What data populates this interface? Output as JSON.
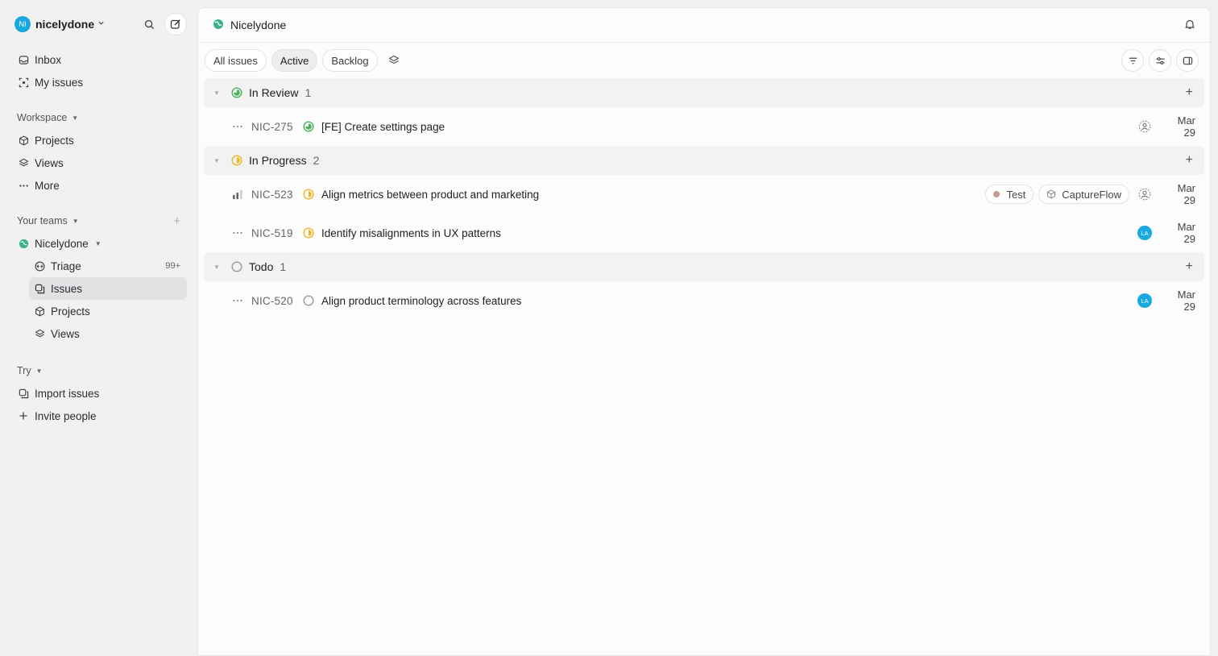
{
  "workspace": {
    "initials": "NI",
    "name": "nicelydone"
  },
  "nav": {
    "inbox": "Inbox",
    "my_issues": "My issues"
  },
  "workspace_section": {
    "label": "Workspace",
    "items": [
      {
        "label": "Projects"
      },
      {
        "label": "Views"
      },
      {
        "label": "More"
      }
    ]
  },
  "teams_section": {
    "label": "Your teams",
    "team": {
      "name": "Nicelydone"
    },
    "items": [
      {
        "label": "Triage",
        "badge": "99+"
      },
      {
        "label": "Issues"
      },
      {
        "label": "Projects"
      },
      {
        "label": "Views"
      }
    ]
  },
  "try_section": {
    "label": "Try",
    "items": [
      {
        "label": "Import issues"
      },
      {
        "label": "Invite people"
      }
    ]
  },
  "header": {
    "title": "Nicelydone"
  },
  "tabs": [
    {
      "label": "All issues"
    },
    {
      "label": "Active"
    },
    {
      "label": "Backlog"
    }
  ],
  "groups": [
    {
      "name": "In Review",
      "count": "1",
      "issues": [
        {
          "id": "NIC-275",
          "title": "[FE] Create settings page",
          "date": "Mar 29"
        }
      ]
    },
    {
      "name": "In Progress",
      "count": "2",
      "issues": [
        {
          "id": "NIC-523",
          "title": "Align metrics between product and marketing",
          "label": "Test",
          "project": "CaptureFlow",
          "date": "Mar 29"
        },
        {
          "id": "NIC-519",
          "title": "Identify misalignments in UX patterns",
          "assignee": "LA",
          "date": "Mar 29"
        }
      ]
    },
    {
      "name": "Todo",
      "count": "1",
      "issues": [
        {
          "id": "NIC-520",
          "title": "Align product terminology across features",
          "assignee": "LA",
          "date": "Mar 29"
        }
      ]
    }
  ],
  "colors": {
    "accent": "#1aa8e0",
    "in_review": "#4cb35b",
    "in_progress": "#e8b820",
    "todo": "#9a9aa0",
    "label_test": "#c79a94"
  }
}
